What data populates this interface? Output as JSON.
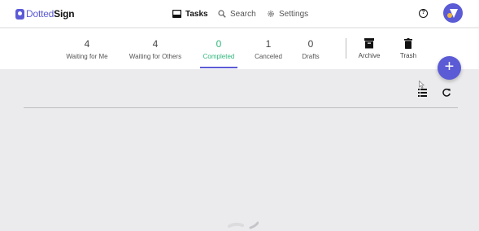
{
  "brand": {
    "name_part1": "Dotted",
    "name_part2": "Sign",
    "color": "#5b5bd6"
  },
  "nav": {
    "tasks": {
      "label": "Tasks",
      "icon": "inbox-icon"
    },
    "search": {
      "label": "Search",
      "icon": "search-icon"
    },
    "settings": {
      "label": "Settings",
      "icon": "gear-icon"
    },
    "help": {
      "label": "?",
      "icon": "help-icon"
    }
  },
  "tabs": [
    {
      "count": "4",
      "label": "Waiting for Me"
    },
    {
      "count": "4",
      "label": "Waiting for Others"
    },
    {
      "count": "0",
      "label": "Completed",
      "active": true
    },
    {
      "count": "1",
      "label": "Canceled"
    },
    {
      "count": "0",
      "label": "Drafts"
    }
  ],
  "extra_tabs": [
    {
      "label": "Archive",
      "icon": "archive-icon"
    },
    {
      "label": "Trash",
      "icon": "trash-icon"
    }
  ],
  "fab": {
    "label": "+",
    "icon": "plus-icon"
  },
  "toolbar": {
    "list_icon": "list-view-icon",
    "refresh_icon": "refresh-icon"
  },
  "colors": {
    "accent": "#5b5bd6",
    "active_tab_text": "#2fb67c",
    "content_bg": "#ebebed"
  }
}
